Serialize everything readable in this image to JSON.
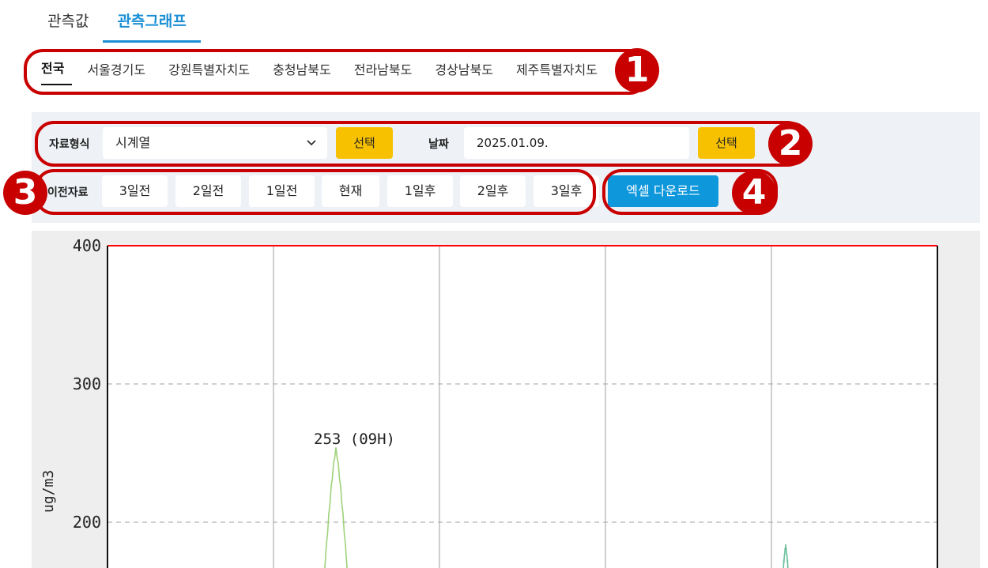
{
  "top_tabs": [
    {
      "label": "관측값",
      "active": false
    },
    {
      "label": "관측그래프",
      "active": true
    }
  ],
  "region_tabs": [
    {
      "label": "전국",
      "active": true
    },
    {
      "label": "서울경기도"
    },
    {
      "label": "강원특별자치도"
    },
    {
      "label": "충청남북도"
    },
    {
      "label": "전라남북도"
    },
    {
      "label": "경상남북도"
    },
    {
      "label": "제주특별자치도"
    }
  ],
  "annotations": [
    "1",
    "2",
    "3",
    "4"
  ],
  "controls": {
    "data_type_label": "자료형식",
    "data_type_value": "시계열",
    "select_button": "선택",
    "date_label": "날짜",
    "date_value": "2025.01.09.",
    "date_select_button": "선택",
    "nav_label": "이전자료",
    "nav_buttons": [
      "3일전",
      "2일전",
      "1일전",
      "현재",
      "1일후",
      "2일후",
      "3일후"
    ],
    "excel_button": "엑셀 다운로드",
    "chevron_icon": "chevron-down-icon"
  },
  "colors": {
    "accent": "#1a8fd6",
    "annotation": "#c80000",
    "yellow_button": "#f7c100",
    "blue_button": "#0f97dc",
    "series_light_green": "#9ed37a",
    "series_teal": "#6fbf9f",
    "top_line": "#ff0000"
  },
  "chart_data": {
    "type": "line",
    "ylabel": "ug/m3",
    "ylim": [
      0,
      400
    ],
    "yticks": [
      "400",
      "300",
      "200"
    ],
    "grid": true,
    "peak_annotation": "253 (09H)",
    "series": [
      {
        "color": "#9ed37a",
        "peak_value": 253
      },
      {
        "color": "#6fbf9f",
        "peak_value": 183
      }
    ]
  }
}
